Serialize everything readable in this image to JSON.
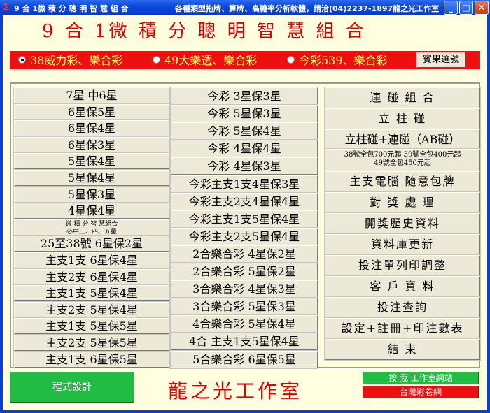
{
  "window": {
    "title": "9 合 1微 積 分 聰 明 智 慧 組 合",
    "info": "各種類型拖牌、算牌、高機率分析軟體，請洽(04)2237-1897龍之光工作室",
    "min_label": "_",
    "max_label": "□",
    "close_label": "✕"
  },
  "header": {
    "main_title": "9  合 1微 積 分 聰 明 智 慧 組 合"
  },
  "lottery": {
    "options": [
      {
        "label": "38威力彩、樂合彩",
        "selected": true
      },
      {
        "label": "49大樂透、樂合彩",
        "selected": false
      },
      {
        "label": "今彩539、樂合彩",
        "selected": false
      }
    ],
    "result_button": "賓果選號"
  },
  "left_buttons": [
    "7星 中6星",
    "6星保5星",
    "6星保4星",
    "6星保3星",
    "5星保4星",
    "5星保4星",
    "5星保3星",
    "4星保4星",
    "微 積 分 智 慧組合\n必中三、四、五星",
    "25至38號  6星保2星",
    "主支1支   6星保4星",
    "主支2支   6星保4星",
    "主支1支   5星保4星",
    "主支2支   5星保4星",
    "主支1支   5星保5星",
    "主支2支   5星保5星",
    "主支1支   6星保5星"
  ],
  "center_buttons": [
    "今彩  3星保3星",
    "今彩  5星保3星",
    "今彩  5星保4星",
    "今彩  4星保4星",
    "今彩  4星保3星",
    "今彩主支1支4星保3星",
    "今彩主支2支4星保4星",
    "今彩主支1支5星保4星",
    "今彩主支2支5星保4星",
    "2合樂合彩   4星保2星",
    "2合樂合彩   5星保2星",
    "3合樂合彩   4星保3星",
    "3合樂合彩   5星保3星",
    "4合樂合彩   5星保4星",
    "4合  主支1支5星保4星",
    "5合樂合彩   6星保5星"
  ],
  "right_buttons": [
    "連 碰 組 合",
    "立   柱   碰",
    "立柱碰+連碰（AB碰）",
    "38號全包700元起  39號全包400元起\n49號全包450元起",
    "主支電腦 隨意包牌",
    "對 獎 處 理",
    "開獎歷史資料",
    "資料庫更新",
    "投注單列印調整",
    "客 戶 資 料",
    "投注查詢",
    "設定+註冊+印注數表",
    "結   束"
  ],
  "footer": {
    "design_button": "程式設計",
    "studio_name": "龍之光工作室",
    "link_studio": "按 我 工作室網站",
    "link_lottery": "台灣彩卷網"
  }
}
